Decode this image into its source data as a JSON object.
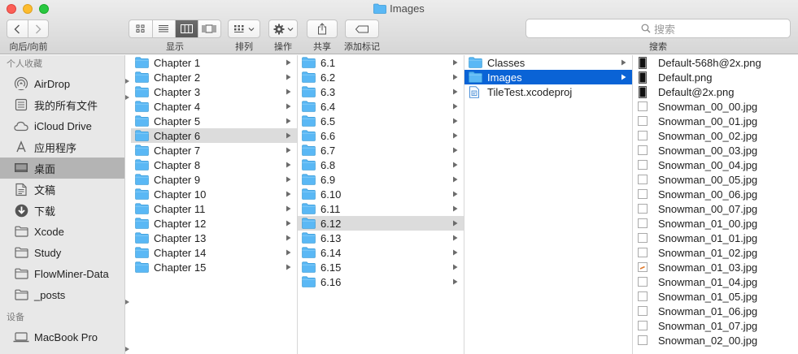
{
  "window": {
    "title": "Images"
  },
  "toolbar": {
    "nav_label": "向后/向前",
    "view_label": "显示",
    "arrange_label": "排列",
    "action_label": "操作",
    "share_label": "共享",
    "tag_label": "添加标记",
    "search_placeholder": "搜索",
    "search_label": "搜索"
  },
  "sidebar": {
    "favorites_header": "个人收藏",
    "favorites": [
      {
        "label": "AirDrop",
        "icon": "airdrop-icon"
      },
      {
        "label": "我的所有文件",
        "icon": "all-files-icon"
      },
      {
        "label": "iCloud Drive",
        "icon": "cloud-icon"
      },
      {
        "label": "应用程序",
        "icon": "applications-icon"
      },
      {
        "label": "桌面",
        "icon": "desktop-icon",
        "selected": true
      },
      {
        "label": "文稿",
        "icon": "documents-icon"
      },
      {
        "label": "下载",
        "icon": "download-icon"
      },
      {
        "label": "Xcode",
        "icon": "folder-icon"
      },
      {
        "label": "Study",
        "icon": "folder-icon"
      },
      {
        "label": "FlowMiner-Data",
        "icon": "folder-icon"
      },
      {
        "label": "_posts",
        "icon": "folder-icon"
      }
    ],
    "devices_header": "设备",
    "devices": [
      {
        "label": "MacBook Pro",
        "icon": "laptop-icon"
      }
    ]
  },
  "columns": {
    "chapters": [
      "Chapter 1",
      "Chapter 2",
      "Chapter 3",
      "Chapter 4",
      "Chapter 5",
      "Chapter 6",
      "Chapter 7",
      "Chapter 8",
      "Chapter 9",
      "Chapter 10",
      "Chapter 11",
      "Chapter 12",
      "Chapter 13",
      "Chapter 14",
      "Chapter 15"
    ],
    "chapters_selected": 5,
    "sections": [
      "6.1",
      "6.2",
      "6.3",
      "6.4",
      "6.5",
      "6.6",
      "6.7",
      "6.8",
      "6.9",
      "6.10",
      "6.11",
      "6.12",
      "6.13",
      "6.14",
      "6.15",
      "6.16"
    ],
    "sections_selected": 11,
    "project": [
      {
        "label": "Classes",
        "type": "folder"
      },
      {
        "label": "Images",
        "type": "folder",
        "selected": true
      },
      {
        "label": "TileTest.xcodeproj",
        "type": "xcodeproj"
      }
    ],
    "images": [
      {
        "label": "Default-568h@2x.png",
        "thumb": "black"
      },
      {
        "label": "Default.png",
        "thumb": "black"
      },
      {
        "label": "Default@2x.png",
        "thumb": "black"
      },
      {
        "label": "Snowman_00_00.jpg",
        "thumb": "blank"
      },
      {
        "label": "Snowman_00_01.jpg",
        "thumb": "blank"
      },
      {
        "label": "Snowman_00_02.jpg",
        "thumb": "blank"
      },
      {
        "label": "Snowman_00_03.jpg",
        "thumb": "blank"
      },
      {
        "label": "Snowman_00_04.jpg",
        "thumb": "blank"
      },
      {
        "label": "Snowman_00_05.jpg",
        "thumb": "blank"
      },
      {
        "label": "Snowman_00_06.jpg",
        "thumb": "blank"
      },
      {
        "label": "Snowman_00_07.jpg",
        "thumb": "blank"
      },
      {
        "label": "Snowman_01_00.jpg",
        "thumb": "blank"
      },
      {
        "label": "Snowman_01_01.jpg",
        "thumb": "blank"
      },
      {
        "label": "Snowman_01_02.jpg",
        "thumb": "blank"
      },
      {
        "label": "Snowman_01_03.jpg",
        "thumb": "carrot"
      },
      {
        "label": "Snowman_01_04.jpg",
        "thumb": "blank"
      },
      {
        "label": "Snowman_01_05.jpg",
        "thumb": "blank"
      },
      {
        "label": "Snowman_01_06.jpg",
        "thumb": "blank"
      },
      {
        "label": "Snowman_01_07.jpg",
        "thumb": "blank"
      },
      {
        "label": "Snowman_02_00.jpg",
        "thumb": "blank"
      }
    ]
  },
  "colors": {
    "selection_blue": "#0a63d6",
    "selection_grey": "#dcdcdc",
    "folder_blue": "#5ab8f5"
  }
}
